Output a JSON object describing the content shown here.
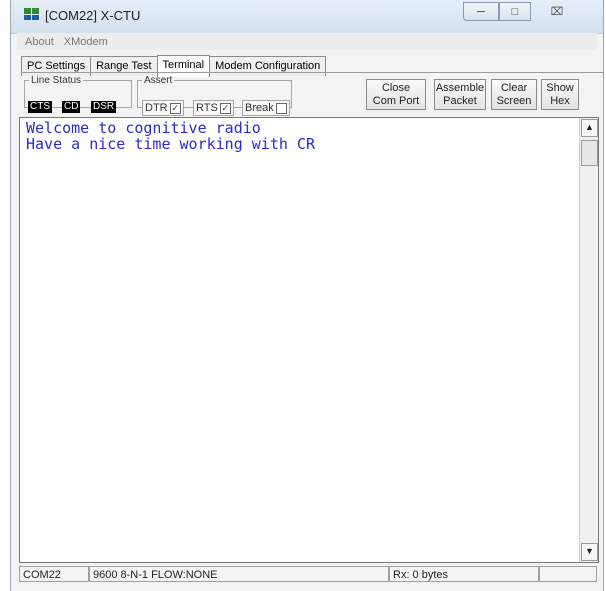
{
  "window": {
    "title": "[COM22] X-CTU"
  },
  "menu": [
    "About",
    "XModem"
  ],
  "tabs": [
    {
      "label": "PC Settings"
    },
    {
      "label": "Range Test"
    },
    {
      "label": "Terminal"
    },
    {
      "label": "Modem Configuration"
    }
  ],
  "line_status": {
    "label": "Line Status",
    "cts": "CTS",
    "cd": "CD",
    "dsr": "DSR"
  },
  "assert": {
    "label": "Assert",
    "dtr": "DTR",
    "rts": "RTS",
    "brk": "Break",
    "dtr_checked": "✓",
    "rts_checked": "✓"
  },
  "buttons": {
    "close_line1": "Close",
    "close_line2": "Com Port",
    "assemble_line1": "Assemble",
    "assemble_line2": "Packet",
    "clear_line1": "Clear",
    "clear_line2": "Screen",
    "show_line1": "Show",
    "show_line2": "Hex"
  },
  "terminal": {
    "line1": "Welcome to cognitive radio",
    "line2": "Have a nice time working with CR"
  },
  "status": {
    "port": "COM22",
    "settings": "9600 8-N-1  FLOW:NONE",
    "rx": "Rx: 0 bytes"
  },
  "colors": {
    "terminal_text": "#2a2ad8",
    "led_bg": "#000000"
  }
}
